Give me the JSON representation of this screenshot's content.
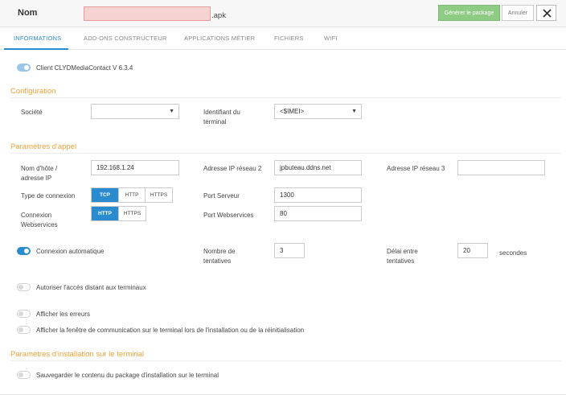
{
  "header": {
    "name_label": "Nom",
    "name_value": "",
    "apk_suffix": ".apk",
    "generate_label": "Générer le package",
    "cancel_label": "Annuler",
    "close_icon": "close-icon"
  },
  "tabs": [
    {
      "label": "INFORMATIONS",
      "active": true
    },
    {
      "label": "ADD-ONS CONSTRUCTEUR",
      "active": false
    },
    {
      "label": "APPLICATIONS MÉTIER",
      "active": false
    },
    {
      "label": "FICHIERS",
      "active": false
    },
    {
      "label": "WIFI",
      "active": false
    }
  ],
  "client": {
    "label": "Client CLYDMediaContact V 6.3.4",
    "enabled": true
  },
  "configuration": {
    "title": "Configuration",
    "societe_label": "Société",
    "societe_value": "",
    "terminal_label_1": "Identifiant du",
    "terminal_label_2": "terminal",
    "terminal_value": "<$IMEI>"
  },
  "appel": {
    "title": "Paramètres d'appel",
    "host_label_1": "Nom d'hôte /",
    "host_label_2": "adresse IP",
    "host_value": "192.168.1.24",
    "ip2_label": "Adresse IP réseau 2",
    "ip2_value": "jpbuteau.ddns.net",
    "ip3_label": "Adresse IP réseau 3",
    "ip3_value": "",
    "conn_type_label": "Type de connexion",
    "conn_type_options": [
      "TCP",
      "HTTP",
      "HTTPS"
    ],
    "conn_type_selected": "TCP",
    "port_serveur_label": "Port Serveur",
    "port_serveur_value": "1300",
    "ws_label_1": "Connexion",
    "ws_label_2": "Webservices",
    "ws_options": [
      "HTTP",
      "HTTPS"
    ],
    "ws_selected": "HTTP",
    "port_ws_label": "Port Webservices",
    "port_ws_value": "80",
    "auto_label": "Connexion automatique",
    "auto_enabled": true,
    "tries_label_1": "Nombre de",
    "tries_label_2": "tentatives",
    "tries_value": "3",
    "delay_label_1": "Délai entre",
    "delay_label_2": "tentatives",
    "delay_value": "20",
    "delay_unit": "secondes",
    "remote_label": "Autoriser l'accès distant aux terminaux",
    "remote_enabled": false,
    "errors_label": "Afficher les erreurs",
    "errors_enabled": false,
    "comm_label": "Afficher la fenêtre de communication sur le terminal lors de l'installation ou de la réinitialisation",
    "comm_enabled": false
  },
  "install": {
    "title": "Paramètres d'installation sur le terminal",
    "save_label": "Sauvegarder le contenu du package d'installation sur le terminal",
    "save_enabled": false
  },
  "colors": {
    "accent": "#2a8ccf",
    "section": "#eda23b",
    "generate": "#8fcb85",
    "invalid": "#f6d3d3"
  }
}
